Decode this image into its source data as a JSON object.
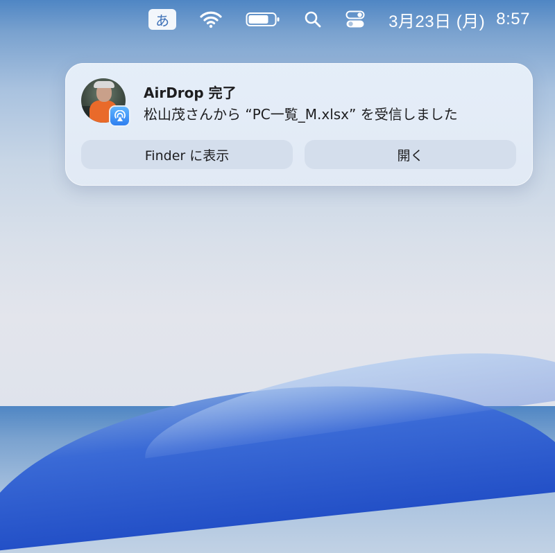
{
  "menubar": {
    "input_method": "あ",
    "date": "3月23日 (月)",
    "time": "8:57",
    "icons": [
      "wifi-icon",
      "battery-icon",
      "spotlight-search-icon",
      "control-center-icon"
    ]
  },
  "notification": {
    "title": "AirDrop 完了",
    "message": "松山茂さんから “PC一覧_M.xlsx” を受信しました",
    "buttons": {
      "show_in_finder": "Finder に表示",
      "open": "開く"
    },
    "badge_icon": "airdrop-icon"
  },
  "colors": {
    "airdrop_blue": "#2f7ff0",
    "wallpaper_top": "#4f86c4",
    "wallpaper_wave": "#2350c7"
  }
}
